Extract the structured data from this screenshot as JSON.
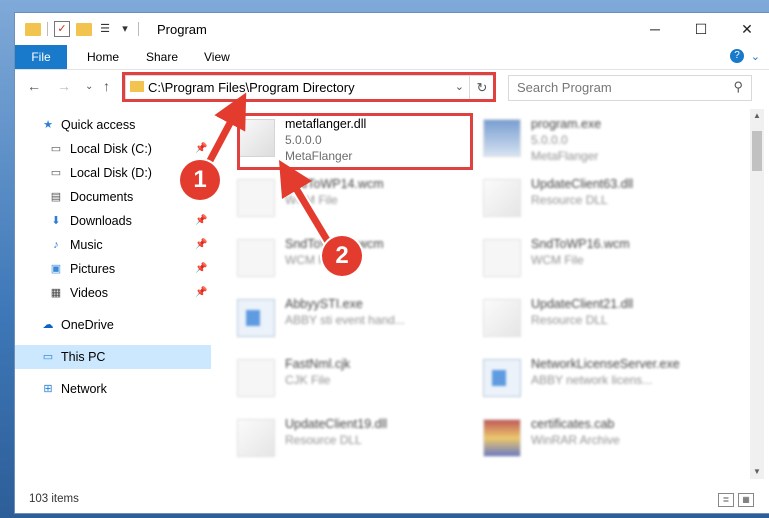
{
  "window": {
    "title": "Program"
  },
  "ribbon": {
    "tabs": [
      "File",
      "Home",
      "Share",
      "View"
    ]
  },
  "nav": {
    "address_path": "C:\\Program Files\\Program Directory",
    "search_placeholder": "Search Program"
  },
  "sidebar": {
    "items": [
      {
        "label": "Quick access",
        "icon": "star-icon",
        "pinned": false
      },
      {
        "label": "Local Disk (C:)",
        "icon": "drive-icon",
        "pinned": true
      },
      {
        "label": "Local Disk (D:)",
        "icon": "drive-icon",
        "pinned": false
      },
      {
        "label": "Documents",
        "icon": "documents-icon",
        "pinned": true
      },
      {
        "label": "Downloads",
        "icon": "downloads-icon",
        "pinned": true
      },
      {
        "label": "Music",
        "icon": "music-icon",
        "pinned": true
      },
      {
        "label": "Pictures",
        "icon": "pictures-icon",
        "pinned": true
      },
      {
        "label": "Videos",
        "icon": "videos-icon",
        "pinned": true
      },
      {
        "label": "OneDrive",
        "icon": "cloud-icon",
        "pinned": false
      },
      {
        "label": "This PC",
        "icon": "pc-icon",
        "pinned": false,
        "selected": true
      },
      {
        "label": "Network",
        "icon": "network-icon",
        "pinned": false
      }
    ]
  },
  "files": [
    {
      "name": "metaflanger.dll",
      "line1": "5.0.0.0",
      "line2": "MetaFlanger",
      "highlighted": true
    },
    {
      "name": "program.exe",
      "line1": "5.0.0.0",
      "line2": "MetaFlanger"
    },
    {
      "name": "SndToWP14.wcm",
      "line1": "WCM File",
      "line2": ""
    },
    {
      "name": "UpdateClient63.dll",
      "line1": "Resource DLL",
      "line2": ""
    },
    {
      "name": "SndToWP15.wcm",
      "line1": "WCM File",
      "line2": ""
    },
    {
      "name": "SndToWP16.wcm",
      "line1": "WCM File",
      "line2": ""
    },
    {
      "name": "AbbyySTI.exe",
      "line1": "ABBY sti event hand...",
      "line2": ""
    },
    {
      "name": "UpdateClient21.dll",
      "line1": "Resource DLL",
      "line2": ""
    },
    {
      "name": "FastNml.cjk",
      "line1": "CJK File",
      "line2": ""
    },
    {
      "name": "NetworkLicenseServer.exe",
      "line1": "ABBY network licens...",
      "line2": ""
    },
    {
      "name": "UpdateClient19.dll",
      "line1": "Resource DLL",
      "line2": ""
    },
    {
      "name": "certificates.cab",
      "line1": "WinRAR Archive",
      "line2": ""
    }
  ],
  "annotations": [
    {
      "number": "1"
    },
    {
      "number": "2"
    }
  ],
  "status": {
    "item_count": "103 items"
  },
  "colors": {
    "accent": "#1979ca",
    "highlight": "#e04040",
    "badge": "#e33b2e"
  }
}
